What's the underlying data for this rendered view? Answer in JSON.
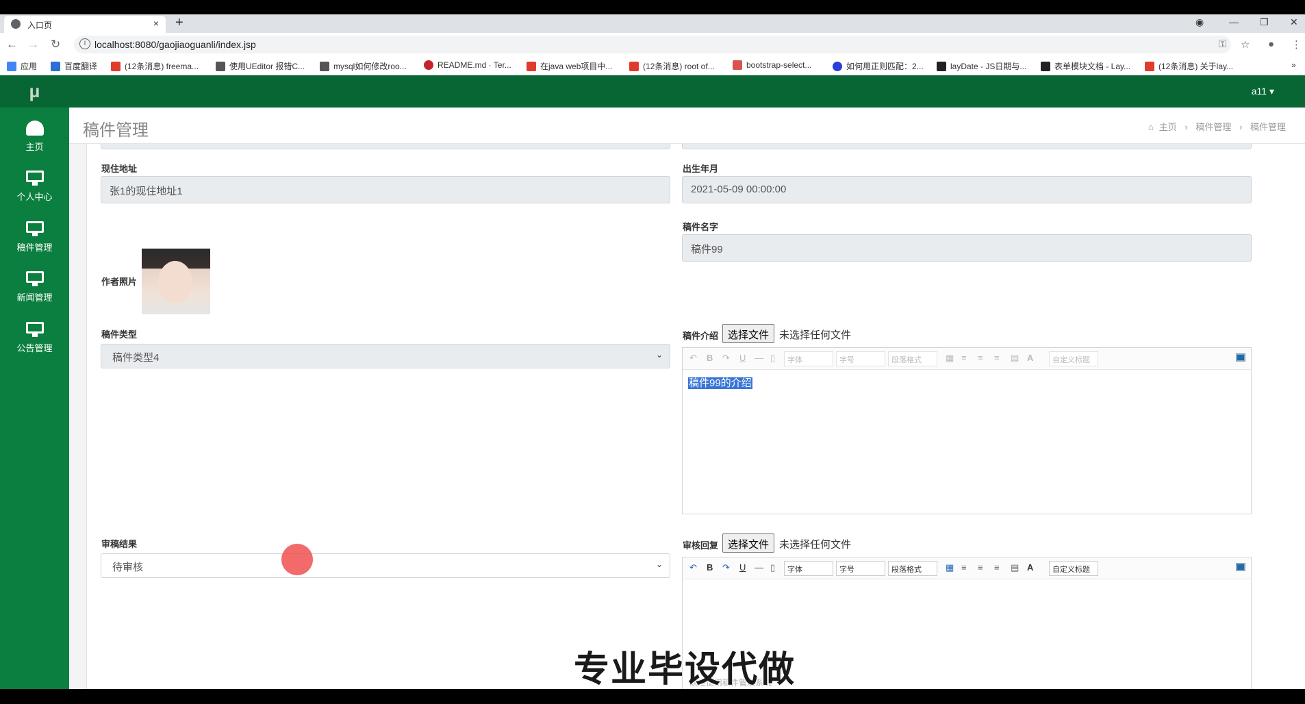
{
  "browser": {
    "tab_title": "入口页",
    "tab_close": "×",
    "new_tab": "+",
    "url": "localhost:8080/gaojiaoguanli/index.jsp",
    "bookmarks": [
      {
        "label": "应用",
        "color": "#4285f4"
      },
      {
        "label": "百度翻译",
        "color": "#2b6fd6"
      },
      {
        "label": "(12条消息) freema...",
        "color": "#e03c2b"
      },
      {
        "label": "使用UEditor 报错C...",
        "color": "#555555"
      },
      {
        "label": "mysql如何修改roo...",
        "color": "#555555"
      },
      {
        "label": "README.md · Ter...",
        "color": "#c7232b"
      },
      {
        "label": "在java web项目中...",
        "color": "#e03c2b"
      },
      {
        "label": "(12条消息) root of...",
        "color": "#e03c2b"
      },
      {
        "label": "bootstrap-select...",
        "color": "#d9534f"
      },
      {
        "label": "如何用正则匹配：2...",
        "color": "#2b3fd6"
      },
      {
        "label": "layDate - JS日期与...",
        "color": "#222222"
      },
      {
        "label": "表单模块文档 - Lay...",
        "color": "#222222"
      },
      {
        "label": "(12条消息) 关于lay...",
        "color": "#e03c2b"
      }
    ],
    "more": "»"
  },
  "app": {
    "logo": "μ",
    "user": "a11 ▾",
    "theme_color": "#0a7f3f",
    "nav": [
      {
        "label": "主页",
        "icon": "dashboard-icon"
      },
      {
        "label": "个人中心",
        "icon": "monitor-icon"
      },
      {
        "label": "稿件管理",
        "icon": "monitor-icon"
      },
      {
        "label": "新闻管理",
        "icon": "monitor-icon"
      },
      {
        "label": "公告管理",
        "icon": "monitor-icon"
      }
    ],
    "page_title": "稿件管理",
    "breadcrumb": {
      "home": "主页",
      "level1": "稿件管理",
      "level2": "稿件管理",
      "sep": "›"
    }
  },
  "form": {
    "address_label": "现住地址",
    "address_value": "张1的现住地址1",
    "birth_label": "出生年月",
    "birth_value": "2021-05-09 00:00:00",
    "photo_label": "作者照片",
    "manuscript_name_label": "稿件名字",
    "manuscript_name_value": "稿件99",
    "type_label": "稿件类型",
    "type_value": "稿件类型4",
    "intro_label": "稿件介绍",
    "file_button": "选择文件",
    "no_file": "未选择任何文件",
    "intro_content": "稿件99的介绍",
    "result_label": "审稿结果",
    "result_value": "待审核",
    "reply_label": "审核回复"
  },
  "editor_toolbar": {
    "undo": "↶",
    "bold": "B",
    "redo": "↷",
    "underline": "U",
    "hr": "—",
    "page": "▯",
    "font": "字体",
    "size": "字号",
    "paragraph": "段落格式",
    "custom_title": "自定义标题",
    "font_color": "A"
  },
  "overlay": {
    "caption": "专业毕设代做",
    "footer": "欢迎使用稿件管理系统"
  }
}
